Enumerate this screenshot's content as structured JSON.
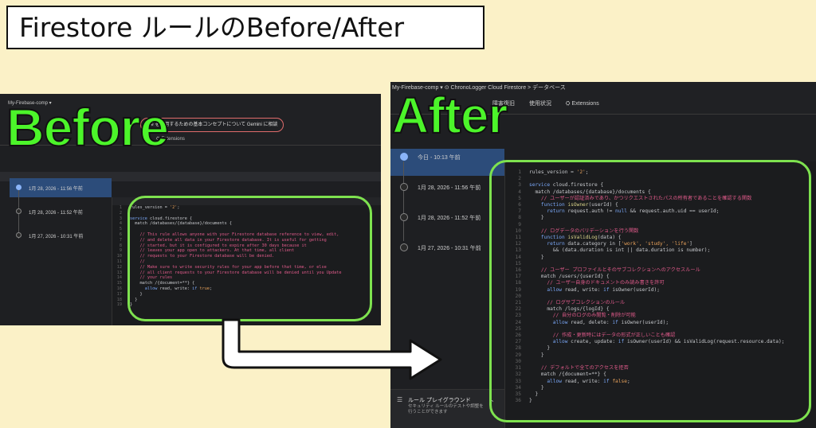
{
  "title": "Firestore ルールのBefore/After",
  "before": {
    "label": "Before",
    "project": "My-Firebase-comp ▾",
    "gemini_hint": "ice を使用するための基本コンセプトについて Gemini に相談",
    "extensions_tab": "Extensions",
    "history": [
      {
        "label": "1月 28, 2026 - 11:56 午前",
        "active": true
      },
      {
        "label": "1月 28, 2026 - 11:52 午前",
        "active": false
      },
      {
        "label": "1月 27, 2026 - 10:31 午前",
        "active": false
      }
    ],
    "code": [
      [
        [
          "c-plain",
          "rules_version = "
        ],
        [
          "c-str",
          "'2'"
        ],
        [
          "c-plain",
          ";"
        ]
      ],
      [
        [
          "c-plain",
          ""
        ]
      ],
      [
        [
          "c-kw",
          "service"
        ],
        [
          "c-plain",
          " cloud.firestore {"
        ]
      ],
      [
        [
          "c-plain",
          "  match /databases/{database}/documents {"
        ]
      ],
      [
        [
          "c-plain",
          ""
        ]
      ],
      [
        [
          "c-cmt",
          "    // This rule allows anyone with your Firestore database reference to view, edit,"
        ]
      ],
      [
        [
          "c-cmt",
          "    // and delete all data in your Firestore database. It is useful for getting"
        ]
      ],
      [
        [
          "c-cmt",
          "    // started, but it is configured to expire after 30 days because it"
        ]
      ],
      [
        [
          "c-cmt",
          "    // leaves your app open to attackers. At that time, all client"
        ]
      ],
      [
        [
          "c-cmt",
          "    // requests to your Firestore database will be denied."
        ]
      ],
      [
        [
          "c-cmt",
          "    //"
        ]
      ],
      [
        [
          "c-cmt",
          "    // Make sure to write security rules for your app before that time, or else"
        ]
      ],
      [
        [
          "c-cmt",
          "    // all client requests to your Firestore database will be denied until you Update"
        ]
      ],
      [
        [
          "c-cmt",
          "    // your rules"
        ]
      ],
      [
        [
          "c-plain",
          "    match /{document=**} {"
        ]
      ],
      [
        [
          "c-kw",
          "      allow"
        ],
        [
          "c-plain",
          " read, write: "
        ],
        [
          "c-kw",
          "if"
        ],
        [
          "c-str",
          " true"
        ],
        [
          "c-plain",
          ";"
        ]
      ],
      [
        [
          "c-plain",
          "    }"
        ]
      ],
      [
        [
          "c-plain",
          "  }"
        ]
      ],
      [
        [
          "c-plain",
          "}"
        ]
      ]
    ]
  },
  "after": {
    "label": "After",
    "breadcrumbs": "My-Firebase-comp  ▾   ⊙ ChronoLogger   Cloud Firestore  >  データベース",
    "tabs": [
      "障害復旧",
      "使用状況",
      "Extensions"
    ],
    "history": [
      {
        "label": "今日 - 10:13 午前",
        "active": true
      },
      {
        "label": "1月 28, 2026 - 11:56 午前",
        "active": false
      },
      {
        "label": "1月 28, 2026 - 11:52 午前",
        "active": false
      },
      {
        "label": "1月 27, 2026 - 10:31 午前",
        "active": false
      }
    ],
    "playground_title": "ルール プレイグラウンド",
    "playground_desc": "セキュリティ ルールのテストや調整を行うことができます",
    "code": [
      [
        [
          "c-plain",
          "rules_version = "
        ],
        [
          "c-str",
          "'2'"
        ],
        [
          "c-plain",
          ";"
        ]
      ],
      [
        [
          "c-plain",
          ""
        ]
      ],
      [
        [
          "c-kw",
          "service"
        ],
        [
          "c-plain",
          " cloud.firestore {"
        ]
      ],
      [
        [
          "c-plain",
          "  match /databases/{database}/documents {"
        ]
      ],
      [
        [
          "c-cmt",
          "    // ユーザーが認証済みであり、かつリクエストされたパスの所有者であることを確認する関数"
        ]
      ],
      [
        [
          "c-kw",
          "    function"
        ],
        [
          "c-fn",
          " isOwner"
        ],
        [
          "c-plain",
          "(userId) {"
        ]
      ],
      [
        [
          "c-kw",
          "      return"
        ],
        [
          "c-plain",
          " request.auth != "
        ],
        [
          "c-kw",
          "null"
        ],
        [
          "c-plain",
          " && request.auth.uid == userId;"
        ]
      ],
      [
        [
          "c-plain",
          "    }"
        ]
      ],
      [
        [
          "c-plain",
          ""
        ]
      ],
      [
        [
          "c-cmt",
          "    // ログデータのバリデーションを行う関数"
        ]
      ],
      [
        [
          "c-kw",
          "    function"
        ],
        [
          "c-fn",
          " isValidLog"
        ],
        [
          "c-plain",
          "(data) {"
        ]
      ],
      [
        [
          "c-kw",
          "      return"
        ],
        [
          "c-plain",
          " data.category in ["
        ],
        [
          "c-str",
          "'work', 'study', 'life'"
        ],
        [
          "c-plain",
          "]"
        ]
      ],
      [
        [
          "c-plain",
          "        && (data.duration is int || data.duration is number);"
        ]
      ],
      [
        [
          "c-plain",
          "    }"
        ]
      ],
      [
        [
          "c-plain",
          ""
        ]
      ],
      [
        [
          "c-cmt",
          "    // ユーザー プロファイルとそのサブコレクションへのアクセスルール"
        ]
      ],
      [
        [
          "c-plain",
          "    match /users/{userId} {"
        ]
      ],
      [
        [
          "c-cmt",
          "      // ユーザー自身のドキュメントのみ読み書きを許可"
        ]
      ],
      [
        [
          "c-kw",
          "      allow"
        ],
        [
          "c-plain",
          " read, write: "
        ],
        [
          "c-kw",
          "if"
        ],
        [
          "c-plain",
          " isOwner(userId);"
        ]
      ],
      [
        [
          "c-plain",
          ""
        ]
      ],
      [
        [
          "c-cmt",
          "      // ログサブコレクションのルール"
        ]
      ],
      [
        [
          "c-plain",
          "      match /logs/{logId} {"
        ]
      ],
      [
        [
          "c-cmt",
          "        // 自分のログのみ閲覧・削除が可能"
        ]
      ],
      [
        [
          "c-kw",
          "        allow"
        ],
        [
          "c-plain",
          " read, delete: "
        ],
        [
          "c-kw",
          "if"
        ],
        [
          "c-plain",
          " isOwner(userId);"
        ]
      ],
      [
        [
          "c-plain",
          ""
        ]
      ],
      [
        [
          "c-cmt",
          "        // 作成・更新時にはデータの形式が正しいことも確認"
        ]
      ],
      [
        [
          "c-kw",
          "        allow"
        ],
        [
          "c-plain",
          " create, update: "
        ],
        [
          "c-kw",
          "if"
        ],
        [
          "c-plain",
          " isOwner(userId) && isValidLog(request.resource.data);"
        ]
      ],
      [
        [
          "c-plain",
          "      }"
        ]
      ],
      [
        [
          "c-plain",
          "    }"
        ]
      ],
      [
        [
          "c-plain",
          ""
        ]
      ],
      [
        [
          "c-cmt",
          "    // デフォルトで全てのアクセスを拒否"
        ]
      ],
      [
        [
          "c-plain",
          "    match /{document=**} {"
        ]
      ],
      [
        [
          "c-kw",
          "      allow"
        ],
        [
          "c-plain",
          " read, write: "
        ],
        [
          "c-kw",
          "if"
        ],
        [
          "c-str",
          " false"
        ],
        [
          "c-plain",
          ";"
        ]
      ],
      [
        [
          "c-plain",
          "    }"
        ]
      ],
      [
        [
          "c-plain",
          "  }"
        ]
      ],
      [
        [
          "c-plain",
          "}"
        ]
      ]
    ]
  }
}
